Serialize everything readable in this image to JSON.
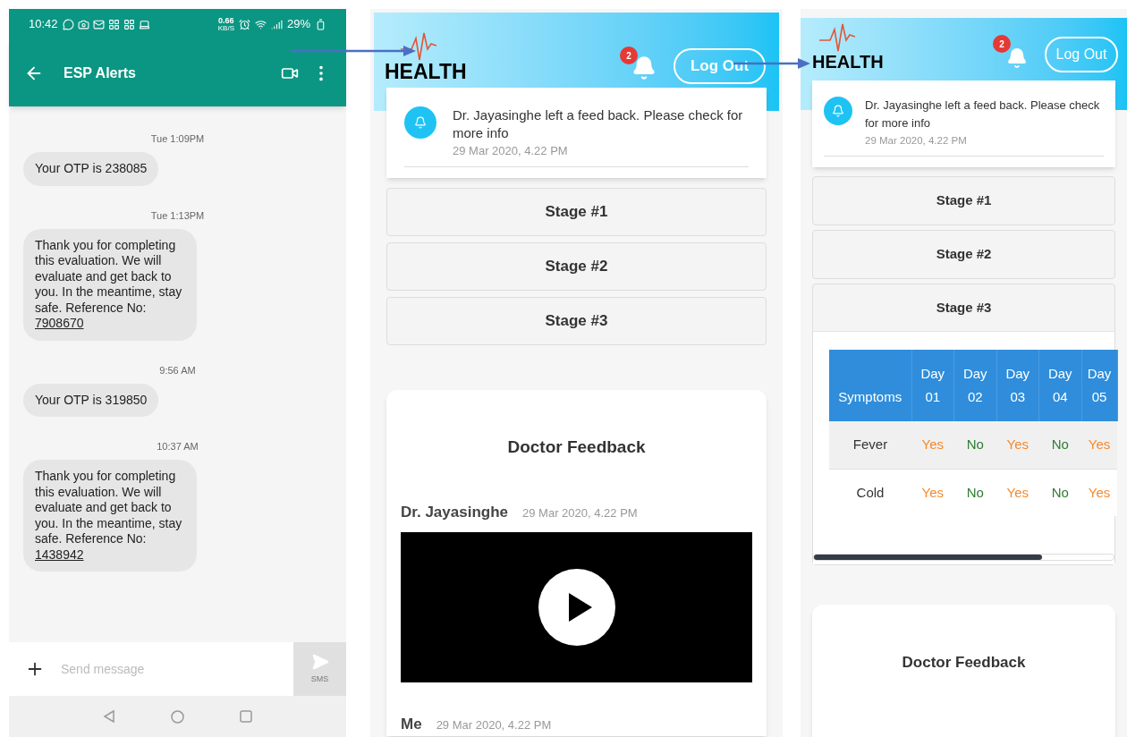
{
  "sms_screen": {
    "status_bar": {
      "time": "10:42",
      "net_speed": "0.66",
      "net_unit": "KB/S",
      "battery": "29%"
    },
    "title": "ESP Alerts",
    "messages": [
      {
        "kind": "time",
        "text": "Tue 1:09PM"
      },
      {
        "kind": "bubble",
        "text": "Your OTP is 238085"
      },
      {
        "kind": "time",
        "text": "Tue 1:13PM"
      },
      {
        "kind": "bubble",
        "text": "Thank you for completing this evaluation. We will evaluate and get back to you. In the meantime, stay safe. Reference No:",
        "link": "7908670"
      },
      {
        "kind": "time",
        "text": "9:56 AM"
      },
      {
        "kind": "bubble",
        "text": "Your OTP is 319850"
      },
      {
        "kind": "time",
        "text": "10:37 AM"
      },
      {
        "kind": "bubble",
        "text": "Thank you for completing this evaluation. We will evaluate and get back to you. In the meantime, stay safe. Reference No:",
        "link": "1438942"
      }
    ],
    "composer": {
      "placeholder": "Send message",
      "send_label": "SMS"
    }
  },
  "health_screens": [
    {
      "logo": "HEALTH",
      "notification_count": "2",
      "logout": "Log Out",
      "notification": {
        "text": "Dr. Jayasinghe left a feed back. Please check for more info",
        "time": "29 Mar 2020, 4.22 PM"
      },
      "stages": [
        {
          "label": "Stage #1",
          "expanded": false
        },
        {
          "label": "Stage #2",
          "expanded": false
        },
        {
          "label": "Stage #3",
          "expanded": false
        }
      ],
      "feedback": {
        "title": "Doctor Feedback",
        "entries": [
          {
            "kind": "video",
            "author": "Dr. Jayasinghe",
            "time": "29 Mar 2020, 4.22 PM"
          },
          {
            "kind": "message",
            "author": "Me",
            "time": "29 Mar 2020, 4.22 PM"
          }
        ]
      }
    },
    {
      "logo": "HEALTH",
      "notification_count": "2",
      "logout": "Log Out",
      "notification": {
        "text": "Dr. Jayasinghe left a feed back. Please check for more info",
        "time": "29 Mar 2020, 4.22 PM"
      },
      "stages": [
        {
          "label": "Stage #1",
          "expanded": false
        },
        {
          "label": "Stage #2",
          "expanded": false
        },
        {
          "label": "Stage #3",
          "expanded": true,
          "symptom_table": {
            "columns": [
              "Symptoms",
              "Day 01",
              "Day 02",
              "Day 03",
              "Day 04",
              "Day 05"
            ],
            "rows": [
              {
                "cells": [
                  {
                    "text": "Fever"
                  },
                  {
                    "text": "Yes",
                    "color": "#f5892c"
                  },
                  {
                    "text": "No",
                    "color": "#2e7d32"
                  },
                  {
                    "text": "Yes",
                    "color": "#f5892c"
                  },
                  {
                    "text": "No",
                    "color": "#2e7d32"
                  },
                  {
                    "text": "Yes",
                    "color": "#f5892c"
                  }
                ]
              },
              {
                "cells": [
                  {
                    "text": "Cold"
                  },
                  {
                    "text": "Yes",
                    "color": "#f5892c"
                  },
                  {
                    "text": "No",
                    "color": "#2e7d32"
                  },
                  {
                    "text": "Yes",
                    "color": "#f5892c"
                  },
                  {
                    "text": "No",
                    "color": "#2e7d32"
                  },
                  {
                    "text": "Yes",
                    "color": "#f5892c"
                  }
                ]
              }
            ]
          }
        }
      ],
      "feedback": {
        "title": "Doctor Feedback"
      }
    }
  ]
}
